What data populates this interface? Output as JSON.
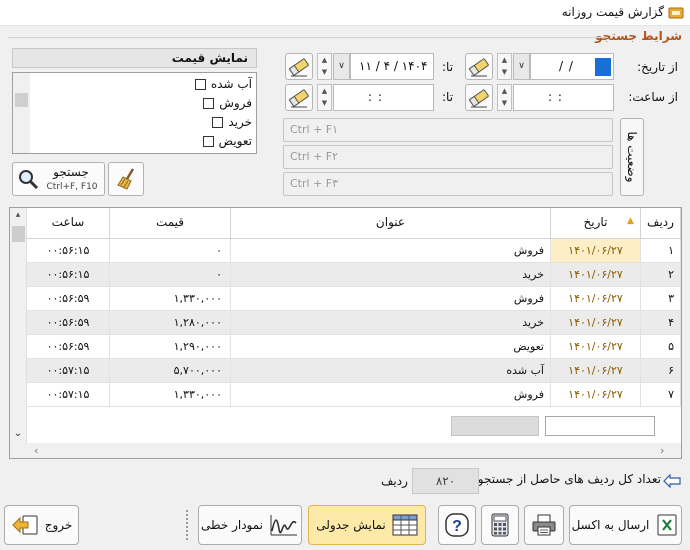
{
  "window": {
    "title": "گزارش قیمت روزانه",
    "icon": "app-icon"
  },
  "search_group": {
    "label": "شرایط جستجو",
    "from_date_label": "از تاریخ:",
    "to_date_label": "تا:",
    "from_time_label": "از ساعت:",
    "to_time_label": "تا:",
    "from_date_value": "/   /",
    "to_date_value": "۱۱ / ۴ / ۱۴۰۴",
    "from_time_value": ":     :",
    "to_time_value": ":     :",
    "ctrl_fields": [
      "Ctrl + F۱",
      "Ctrl + F۲",
      "Ctrl + F۳"
    ],
    "status_button": "وضعیت ها"
  },
  "price_panel": {
    "header": "نمایش قیمت",
    "items": [
      "آب شده",
      "فروش",
      "خرید",
      "تعویض"
    ]
  },
  "search_button": {
    "label": "جستجو",
    "shortcut": "Ctrl+F, F10"
  },
  "grid": {
    "columns": {
      "row": "ردیف",
      "date": "تاریخ",
      "title": "عنوان",
      "price": "قیمت",
      "time": "ساعت"
    },
    "rows": [
      {
        "n": "۱",
        "date": "۱۴۰۱/۰۶/۲۷",
        "title": "فروش",
        "price": "۰",
        "time": "۰۰:۵۶:۱۵"
      },
      {
        "n": "۲",
        "date": "۱۴۰۱/۰۶/۲۷",
        "title": "خرید",
        "price": "۰",
        "time": "۰۰:۵۶:۱۵"
      },
      {
        "n": "۳",
        "date": "۱۴۰۱/۰۶/۲۷",
        "title": "فروش",
        "price": "۱,۳۳۰,۰۰۰",
        "time": "۰۰:۵۶:۵۹"
      },
      {
        "n": "۴",
        "date": "۱۴۰۱/۰۶/۲۷",
        "title": "خرید",
        "price": "۱,۲۸۰,۰۰۰",
        "time": "۰۰:۵۶:۵۹"
      },
      {
        "n": "۵",
        "date": "۱۴۰۱/۰۶/۲۷",
        "title": "تعویض",
        "price": "۱,۲۹۰,۰۰۰",
        "time": "۰۰:۵۶:۵۹"
      },
      {
        "n": "۶",
        "date": "۱۴۰۱/۰۶/۲۷",
        "title": "آب شده",
        "price": "۵,۷۰۰,۰۰۰",
        "time": "۰۰:۵۷:۱۵"
      },
      {
        "n": "۷",
        "date": "۱۴۰۱/۰۶/۲۷",
        "title": "فروش",
        "price": "۱,۳۳۰,۰۰۰",
        "time": "۰۰:۵۷:۱۵"
      }
    ]
  },
  "summary": {
    "label": "تعداد کل ردیف های حاصل از جستجو:",
    "count": "۸۲۰",
    "unit": "ردیف"
  },
  "toolbar": {
    "export_excel": "ارسال به اکسل",
    "table_view": "نمایش جدولی",
    "line_chart": "نمودار خطی",
    "exit": "خروج"
  },
  "colors": {
    "accent": "#b0561b",
    "active_button": "#fde9a8",
    "date_text": "#8a5b00",
    "selection": "#1a6fd6"
  }
}
